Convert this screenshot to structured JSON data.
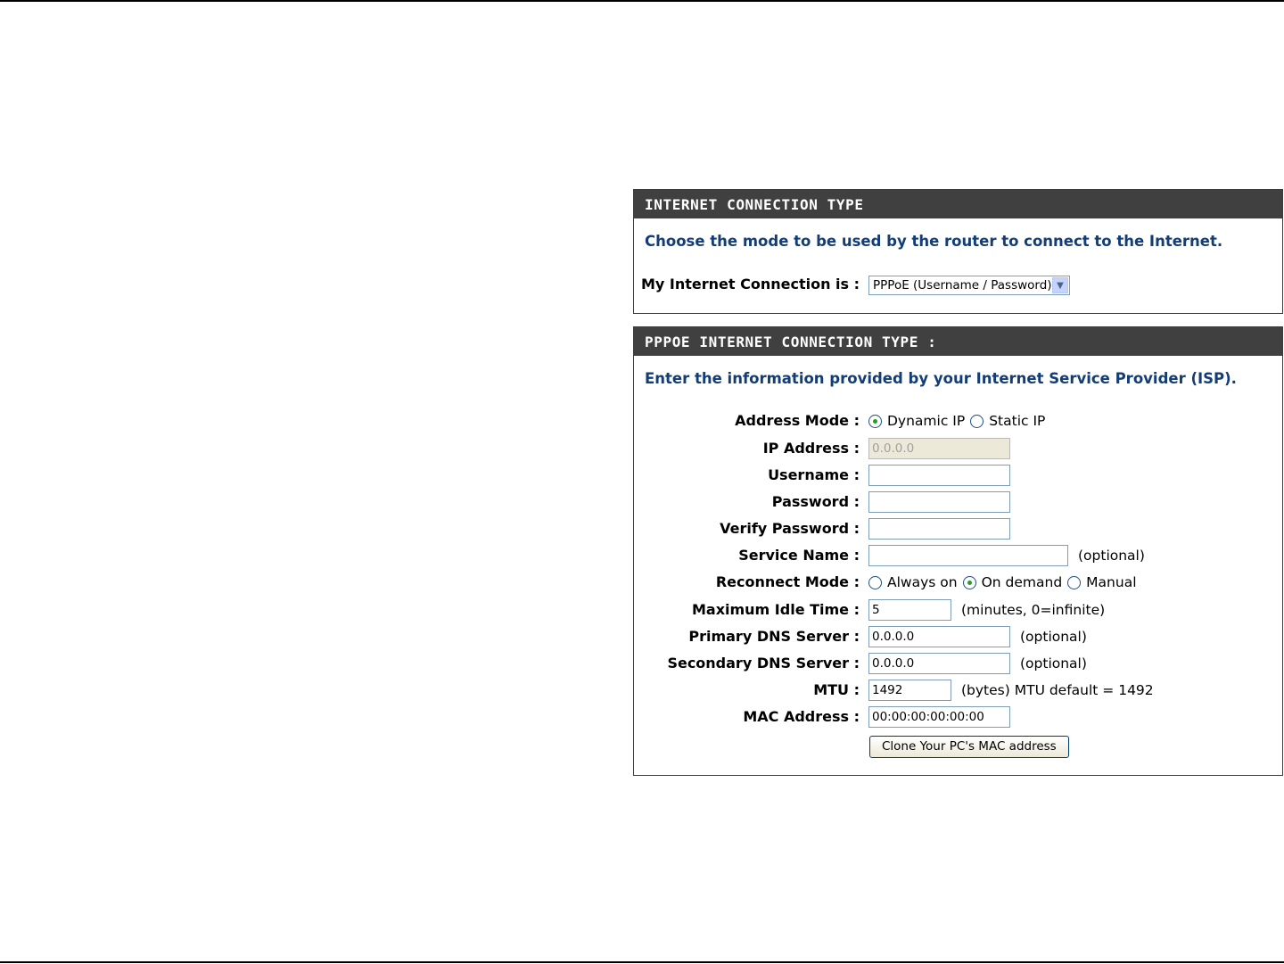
{
  "section1": {
    "title": "INTERNET CONNECTION TYPE",
    "intro": "Choose the mode to be used by the router to connect to the Internet.",
    "connection_label": "My Internet Connection is :",
    "connection_value": "PPPoE (Username / Password)"
  },
  "section2": {
    "title": "PPPOE INTERNET CONNECTION TYPE :",
    "intro": "Enter the information provided by your Internet Service Provider (ISP).",
    "address_mode": {
      "label": "Address Mode :",
      "options": [
        "Dynamic IP",
        "Static IP"
      ],
      "selected": "Dynamic IP"
    },
    "ip_address": {
      "label": "IP Address :",
      "value": "0.0.0.0"
    },
    "username": {
      "label": "Username :",
      "value": ""
    },
    "password": {
      "label": "Password :",
      "value": ""
    },
    "verify_password": {
      "label": "Verify Password :",
      "value": ""
    },
    "service_name": {
      "label": "Service Name :",
      "value": "",
      "hint": "(optional)"
    },
    "reconnect_mode": {
      "label": "Reconnect Mode :",
      "options": [
        "Always on",
        "On demand",
        "Manual"
      ],
      "selected": "On demand"
    },
    "max_idle_time": {
      "label": "Maximum Idle Time :",
      "value": "5",
      "hint": "(minutes, 0=infinite)"
    },
    "primary_dns": {
      "label": "Primary DNS Server :",
      "value": "0.0.0.0",
      "hint": "(optional)"
    },
    "secondary_dns": {
      "label": "Secondary DNS Server :",
      "value": "0.0.0.0",
      "hint": "(optional)"
    },
    "mtu": {
      "label": "MTU :",
      "value": "1492",
      "hint": "(bytes) MTU default = 1492"
    },
    "mac_address": {
      "label": "MAC Address :",
      "value": "00:00:00:00:00:00"
    },
    "clone_button": "Clone Your PC's MAC address"
  },
  "colors": {
    "header_bg": "#404040",
    "intro_text": "#133d77",
    "radio_dot": "#21a121"
  }
}
